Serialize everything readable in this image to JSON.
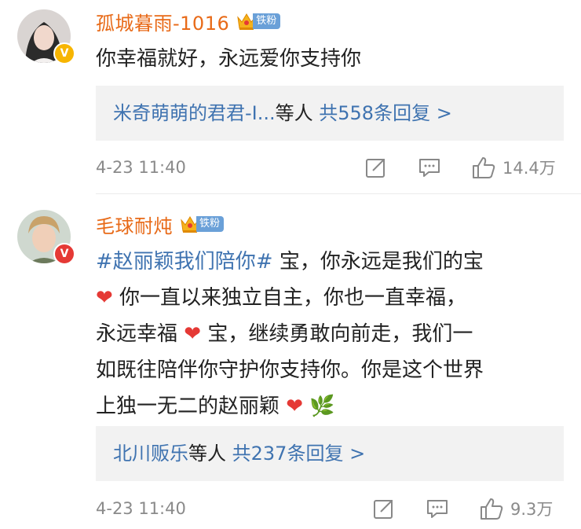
{
  "colors": {
    "username": "#e86a18",
    "link": "#3f73b0",
    "fan_badge": "#6aa0d8",
    "heart": "#e53935",
    "reply_bg": "#f2f2f2",
    "meta_text": "#8a8a8a"
  },
  "comments": [
    {
      "username": "孤城暮雨-1016",
      "fan_badge": "铁粉",
      "badge_icon": "crown-icon",
      "verified_badge": "v-badge-gold",
      "content": "你幸福就好，永远爱你支持你",
      "replies_summary": {
        "users": "米奇萌萌的君君-I...",
        "suffix": "等人",
        "count_text": "共558条回复 >"
      },
      "timestamp": "4-23 11:40",
      "likes": "14.4万"
    },
    {
      "username": "毛球耐炖",
      "fan_badge": "铁粉",
      "badge_icon": "crown-icon",
      "verified_badge": "v-badge-red",
      "content_lines": [
        {
          "topic": "#赵丽颖我们陪你#",
          "text": " 宝，你永远是我们的宝"
        },
        {
          "heart": "❤",
          "text": " 你一直以来独立自主，你也一直幸福，"
        },
        {
          "text": "永远幸福 ",
          "heart": "❤",
          "text2": " 宝，继续勇敢向前走，我们一"
        },
        {
          "text": "如既往陪伴你守护你支持你。你是这个世界"
        },
        {
          "text": "上独一无二的赵丽颖 ",
          "heart": "❤",
          "leaf": "🌿"
        }
      ],
      "replies_summary": {
        "users": "北川贩乐",
        "suffix": "等人",
        "count_text": "共237条回复 >"
      },
      "timestamp": "4-23 11:40",
      "likes": "9.3万"
    }
  ]
}
